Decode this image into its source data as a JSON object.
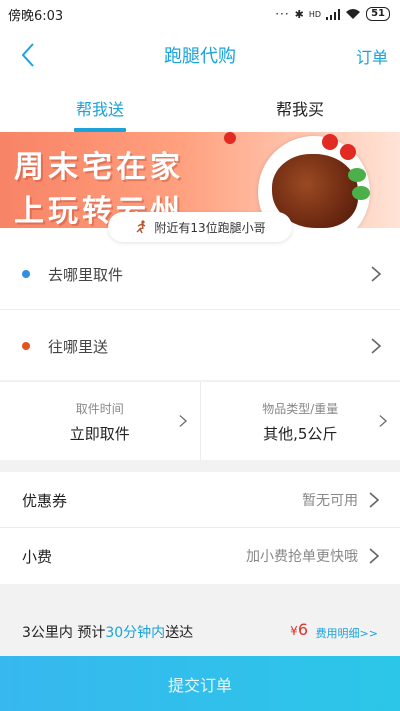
{
  "status_bar": {
    "time": "傍晚6:03",
    "dots": "···",
    "network_label": "HD",
    "battery": "51"
  },
  "navbar": {
    "title": "跑腿代购",
    "order_link": "订单"
  },
  "tabs": [
    {
      "label": "帮我送",
      "active": true
    },
    {
      "label": "帮我买",
      "active": false
    }
  ],
  "banner": {
    "line1": "周末宅在家",
    "line2": "上玩转云州"
  },
  "courier_pill": {
    "text": "附近有13位跑腿小哥"
  },
  "address": {
    "pickup_placeholder": "去哪里取件",
    "dropoff_placeholder": "往哪里送"
  },
  "meta": {
    "pickup_time_label": "取件时间",
    "pickup_time_value": "立即取件",
    "item_type_label": "物品类型/重量",
    "item_type_value": "其他,5公斤"
  },
  "options": {
    "coupon_label": "优惠券",
    "coupon_value": "暂无可用",
    "tip_label": "小费",
    "tip_value": "加小费抢单更快哦"
  },
  "summary": {
    "distance_text": "3公里内  预计",
    "eta_text": "30分钟内",
    "eta_suffix": "送达",
    "currency": "¥",
    "price": "6",
    "detail_link": "费用明细>>"
  },
  "submit": {
    "label": "提交订单"
  },
  "colors": {
    "accent": "#1aa3d9",
    "price": "#e0332a",
    "pickup_dot": "#2f8fe0",
    "dropoff_dot": "#e6521e"
  },
  "icons": {
    "back": "chevron-left-icon",
    "chevron": "chevron-right-icon",
    "runner": "runner-icon",
    "signal": "signal-icon",
    "wifi": "wifi-icon",
    "bluetooth": "bluetooth-icon",
    "battery": "battery-icon"
  }
}
